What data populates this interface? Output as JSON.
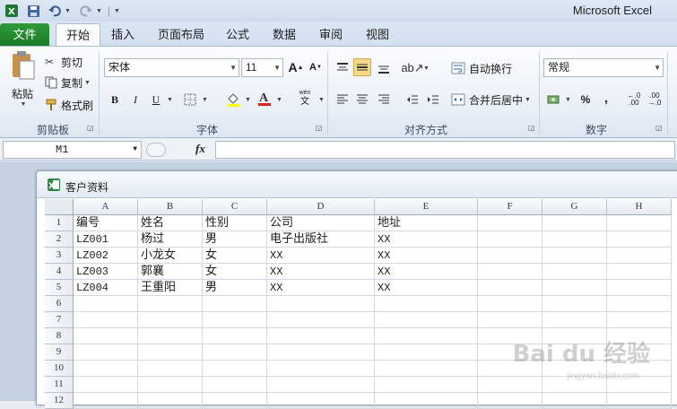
{
  "app": {
    "title": "Microsoft Excel"
  },
  "tabs": [
    {
      "label": "文件"
    },
    {
      "label": "开始"
    },
    {
      "label": "插入"
    },
    {
      "label": "页面布局"
    },
    {
      "label": "公式"
    },
    {
      "label": "数据"
    },
    {
      "label": "审阅"
    },
    {
      "label": "视图"
    }
  ],
  "ribbon": {
    "clipboard": {
      "paste": "粘贴",
      "cut": "剪切",
      "copy": "复制",
      "format_painter": "格式刷",
      "label": "剪贴板"
    },
    "font": {
      "name": "宋体",
      "size": "11",
      "bold": "B",
      "italic": "I",
      "underline": "U",
      "label": "字体"
    },
    "alignment": {
      "wrap_text": "自动换行",
      "merge_center": "合并后居中",
      "label": "对齐方式"
    },
    "number": {
      "format": "常规",
      "percent": "%",
      "comma": ",",
      "label": "数字"
    }
  },
  "formula_bar": {
    "name_box": "M1",
    "fx": "fx",
    "value": ""
  },
  "workbook": {
    "title": "客户资料",
    "columns": [
      "A",
      "B",
      "C",
      "D",
      "E",
      "F",
      "G",
      "H"
    ],
    "rows": [
      "1",
      "2",
      "3",
      "4",
      "5",
      "6",
      "7",
      "8",
      "9",
      "10",
      "11",
      "12"
    ],
    "cells": [
      [
        "编号",
        "姓名",
        "性别",
        "公司",
        "地址"
      ],
      [
        "LZ001",
        "杨过",
        "男",
        "电子出版社",
        "XX"
      ],
      [
        "LZ002",
        "小龙女",
        "女",
        "XX",
        "XX"
      ],
      [
        "LZ003",
        "郭襄",
        "女",
        "XX",
        "XX"
      ],
      [
        "LZ004",
        "王重阳",
        "男",
        "XX",
        "XX"
      ]
    ]
  },
  "watermark": {
    "text": "Bai du 经验",
    "sub": "jingyan.baidu.com"
  }
}
